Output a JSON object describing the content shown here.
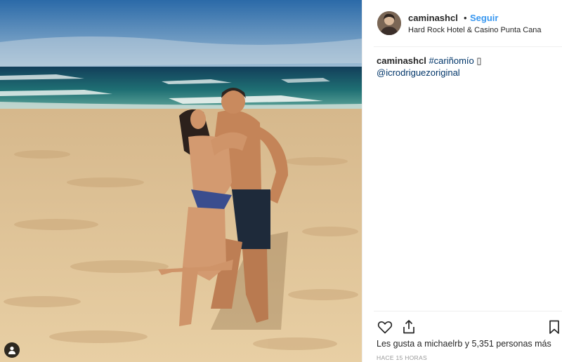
{
  "post": {
    "username": "caminashcl",
    "separator": "•",
    "follow_label": "Seguir",
    "location": "Hard Rock Hotel & Casino Punta Cana",
    "caption": {
      "username": "caminashcl",
      "hashtag": "#cariñomío",
      "emoji": "▯",
      "mention": "@icrodriguezoriginal"
    },
    "likes_text": "Les gusta a michaelrb y 5,351 personas más",
    "time_ago": "HACE 15 HORAS"
  },
  "icons": {
    "like": "heart-icon",
    "share": "share-icon",
    "save": "bookmark-icon",
    "tag": "user-tag-icon"
  },
  "colors": {
    "follow": "#3897f0",
    "link": "#003569",
    "muted": "#999999",
    "text": "#262626"
  }
}
